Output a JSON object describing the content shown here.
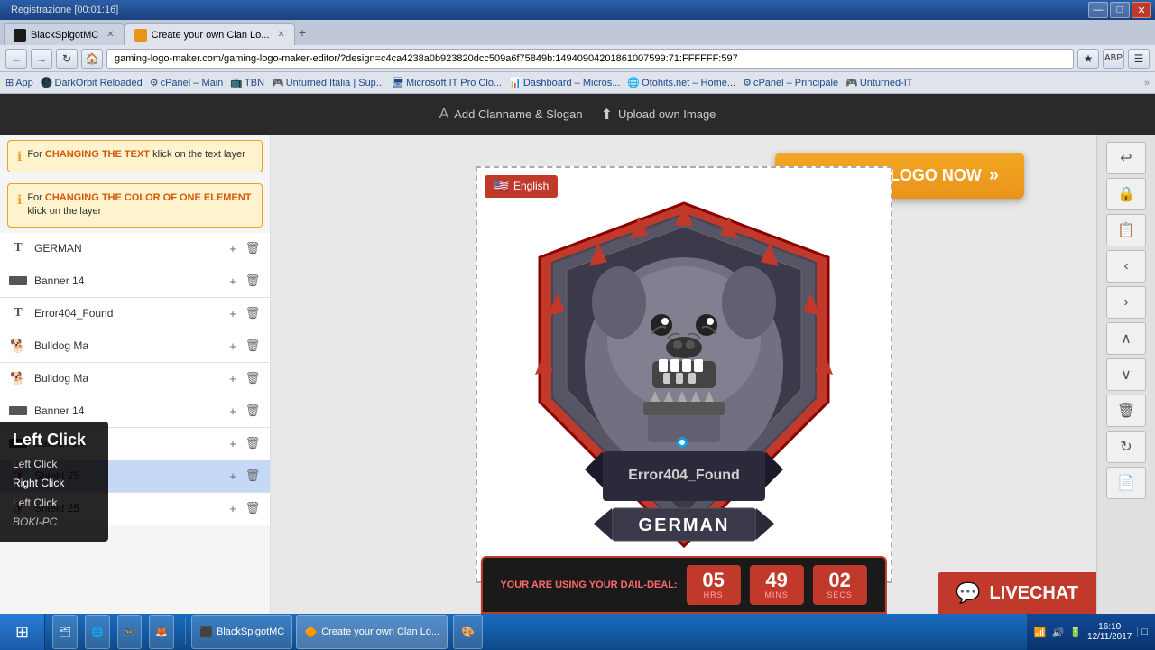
{
  "window": {
    "title": "Create your own Clan Logo",
    "titlebar_buttons": [
      "—",
      "□",
      "✕"
    ]
  },
  "browser": {
    "tabs": [
      {
        "id": "tab1",
        "icon_color": "#1a1a1a",
        "label": "BlackSpigotMC",
        "active": false
      },
      {
        "id": "tab2",
        "icon_color": "#e8941a",
        "label": "Create your own Clan Lo...",
        "active": true
      }
    ],
    "address": "gaming-logo-maker.com/gaming-logo-maker-editor/?design=c4ca4238a0b923820dcc509a6f75849b:14940904201861007599:71:FFFFFF:597",
    "bookmarks": [
      "App",
      "DarkOrbit Reloaded",
      "cPanel – Main",
      "TBN",
      "Unturned Italia | Sup...",
      "Microsoft IT Pro Clo...",
      "Dashboard – Micros...",
      "Otohits.net – Home...",
      "cPanel – Principale",
      "Unturned-IT"
    ],
    "nav_buttons": [
      "←",
      "→",
      "↻",
      "🏠"
    ]
  },
  "toolbar": {
    "items": [
      {
        "icon": "A",
        "label": "Add Clanname & Slogan"
      },
      {
        "icon": "⬆",
        "label": "Upload own Image"
      }
    ]
  },
  "info_boxes": [
    {
      "id": "info1",
      "text_prefix": "For ",
      "highlight": "CHANGING THE TEXT",
      "text_suffix": " klick on the text layer"
    },
    {
      "id": "info2",
      "text_prefix": "For ",
      "highlight": "CHANGING THE COLOR OF ONE ELEMENT",
      "text_suffix": " klick on the layer"
    }
  ],
  "layers": [
    {
      "id": "l1",
      "type": "text",
      "name": "GERMAN",
      "highlighted": false
    },
    {
      "id": "l2",
      "type": "banner",
      "name": "Banner 14",
      "highlighted": false
    },
    {
      "id": "l3",
      "type": "text",
      "name": "Error404_Found",
      "highlighted": false
    },
    {
      "id": "l4",
      "type": "bulldog",
      "name": "Bulldog Ma",
      "highlighted": false
    },
    {
      "id": "l5",
      "type": "bulldog",
      "name": "Bulldog Ma",
      "highlighted": false
    },
    {
      "id": "l6",
      "type": "banner",
      "name": "Banner 14",
      "highlighted": false
    },
    {
      "id": "l7",
      "type": "banner",
      "name": "Banner 14",
      "highlighted": false
    },
    {
      "id": "l8",
      "type": "shield",
      "name": "Shield 25",
      "highlighted": true
    },
    {
      "id": "l9",
      "type": "shield",
      "name": "Shield 25",
      "highlighted": false
    }
  ],
  "language_btn": {
    "flag": "🇺🇸",
    "label": "English"
  },
  "canvas": {
    "logo_text_top": "Error404_Found",
    "logo_text_bottom": "GERMAN"
  },
  "right_sidebar_tools": [
    "↩",
    "🔒",
    "📋",
    "‹",
    "›",
    "∧",
    "∨",
    "🗑",
    "↻",
    "📄"
  ],
  "cta": {
    "label": "GET YOUR LOGO NOW",
    "arrows": "»"
  },
  "deal_bar": {
    "label": "YOUR ARE USING YOUR DAIL-DEAL:",
    "hours": "05",
    "hours_label": "HRS",
    "mins": "49",
    "mins_label": "MINS",
    "secs": "02",
    "secs_label": "SECS"
  },
  "livechat": {
    "label": "LIVECHAT"
  },
  "tooltip": {
    "title": "Left Click",
    "items": [
      "Left Click",
      "Right Click",
      "Left Click"
    ],
    "italic": "BOKI-PC"
  },
  "taskbar": {
    "time": "16:10",
    "date": "12/11/2017",
    "buttons": [
      {
        "label": "BlackSpigotMC"
      },
      {
        "label": "Create your own Clan Lo..."
      }
    ]
  },
  "recording": {
    "label": "Registrazione [00:01:16]"
  }
}
